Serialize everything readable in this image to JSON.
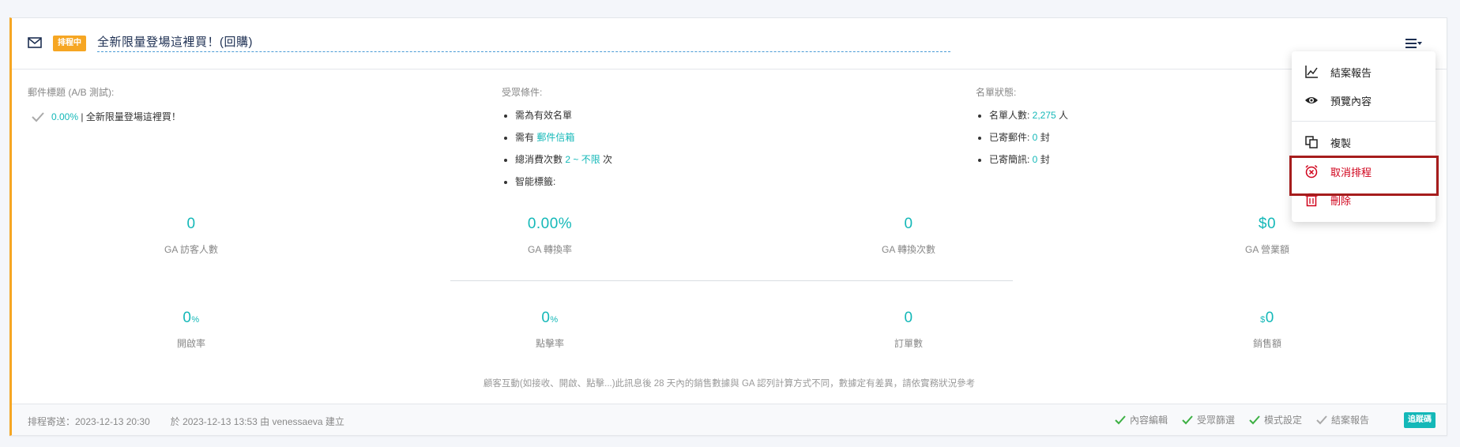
{
  "campaign": {
    "status_badge": "排程中",
    "title": "全新限量登場這裡買！(回購)"
  },
  "subject_section": {
    "label": "郵件標題 (A/B 測試):",
    "rate": "0.00%",
    "separator": " | ",
    "subject": "全新限量登場這裡買！"
  },
  "audience_section": {
    "label": "受眾條件:",
    "item1": "需為有效名單",
    "item2_prefix": "需有 ",
    "item2_value": "郵件信箱",
    "item3_prefix": "總消費次數 ",
    "item3_value": "2 ~ 不限",
    "item3_suffix": " 次",
    "item4": "智能標籤:"
  },
  "list_section": {
    "label": "名單狀態:",
    "item1_prefix": "名單人數: ",
    "item1_value": "2,275",
    "item1_suffix": " 人",
    "item2_prefix": "已寄郵件: ",
    "item2_value": "0",
    "item2_suffix": " 封",
    "item3_prefix": "已寄簡訊: ",
    "item3_value": "0",
    "item3_suffix": " 封"
  },
  "ga_stats": [
    {
      "value": "0",
      "label": "GA 訪客人數"
    },
    {
      "value": "0.00%",
      "label": "GA 轉換率"
    },
    {
      "value": "0",
      "label": "GA 轉換次數"
    },
    {
      "value": "$0",
      "label": "GA 營業額"
    }
  ],
  "email_stats": [
    {
      "value": "0",
      "unit": "%",
      "prefix": "",
      "label": "開啟率"
    },
    {
      "value": "0",
      "unit": "%",
      "prefix": "",
      "label": "點擊率"
    },
    {
      "value": "0",
      "unit": "",
      "prefix": "",
      "label": "訂單數"
    },
    {
      "value": "0",
      "unit": "",
      "prefix": "$",
      "label": "銷售額"
    }
  ],
  "note": "顧客互動(如接收、開啟、點擊...)此訊息後 28 天內的銷售數據與 GA 認列計算方式不同，數據定有差異，請依實務狀況參考",
  "footer": {
    "schedule": "排程寄送：2023-12-13 20:30",
    "created": "於 2023-12-13 13:53 由 venessaeva 建立",
    "steps": [
      {
        "label": "內容編輯",
        "done": true
      },
      {
        "label": "受眾篩選",
        "done": true
      },
      {
        "label": "模式設定",
        "done": true
      },
      {
        "label": "結案報告",
        "done": false
      }
    ],
    "tracking_label": "追蹤碼"
  },
  "menu": {
    "report": "結案報告",
    "preview": "預覽內容",
    "copy": "複製",
    "cancel_schedule": "取消排程",
    "delete": "刪除"
  },
  "colors": {
    "accent": "#14b8b8",
    "status": "#f6a623",
    "danger": "#d0021b",
    "highlight": "#a61d1d"
  }
}
